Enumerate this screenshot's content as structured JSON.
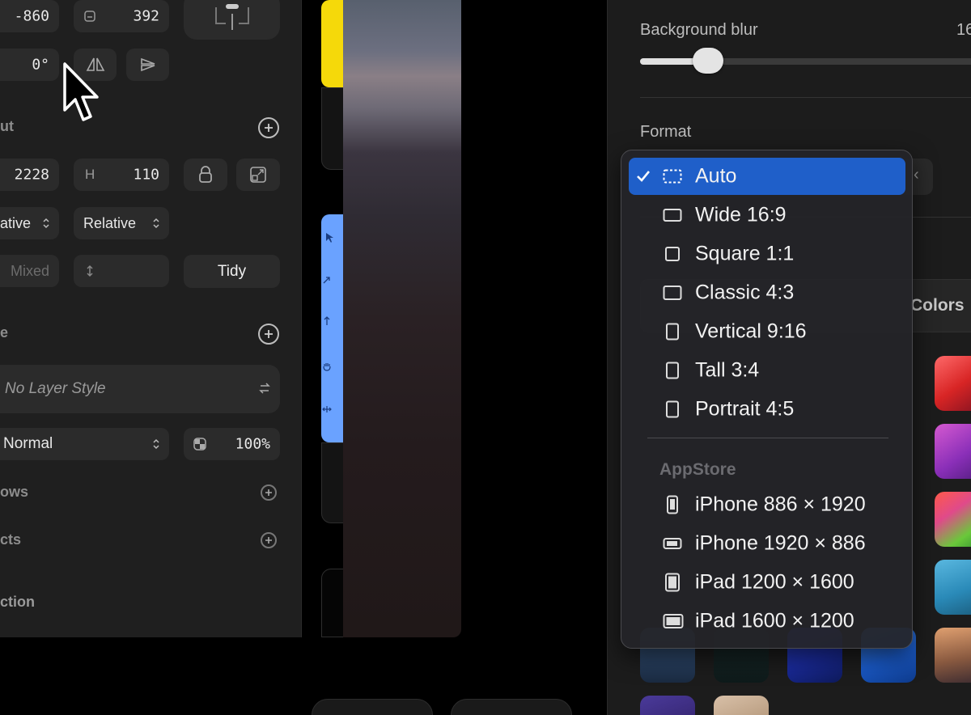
{
  "inspector": {
    "x_value": "-860",
    "height_top_value": "392",
    "rotation_value": "0°",
    "layout_title": "ut",
    "width_value": "2228",
    "height_label": "H",
    "height_value": "110",
    "sizing_left": "ative",
    "sizing_right": "Relative",
    "spacing_mixed": "Mixed",
    "tidy_label": "Tidy",
    "style_section_title": "e",
    "layer_style_value": "No Layer Style",
    "blend_mode": "Normal",
    "opacity_value": "100%",
    "shadows_title": "ows",
    "effects_title": "cts",
    "section_title": "ction"
  },
  "right_panel": {
    "blur_label": "Background blur",
    "blur_value": "16",
    "blur_level_fraction": 0.2,
    "format_label": "Format",
    "colors_tab": "Colors"
  },
  "format_menu": {
    "selected": "Auto",
    "items": [
      {
        "label": "Auto",
        "icon": "dashed-rect-icon",
        "checked": true
      },
      {
        "label": "Wide 16:9",
        "icon": "wide-rect-icon"
      },
      {
        "label": "Square 1:1",
        "icon": "square-icon"
      },
      {
        "label": "Classic 4:3",
        "icon": "classic-rect-icon"
      },
      {
        "label": "Vertical 9:16",
        "icon": "vertical-rect-icon"
      },
      {
        "label": "Tall 3:4",
        "icon": "tall-rect-icon"
      },
      {
        "label": "Portrait 4:5",
        "icon": "portrait-rect-icon"
      }
    ],
    "appstore_header": "AppStore",
    "appstore_items": [
      {
        "label": "iPhone 886 × 1920",
        "icon": "iphone-portrait-icon"
      },
      {
        "label": "iPhone 1920 × 886",
        "icon": "iphone-landscape-icon"
      },
      {
        "label": "iPad 1200 × 1600",
        "icon": "ipad-portrait-icon"
      },
      {
        "label": "iPad 1600 × 1200",
        "icon": "ipad-landscape-icon"
      }
    ]
  },
  "colors": {
    "accent": "#1f5fc9",
    "highlight_yellow": "#f5d90a",
    "tool_blue": "#6aa2ff"
  }
}
